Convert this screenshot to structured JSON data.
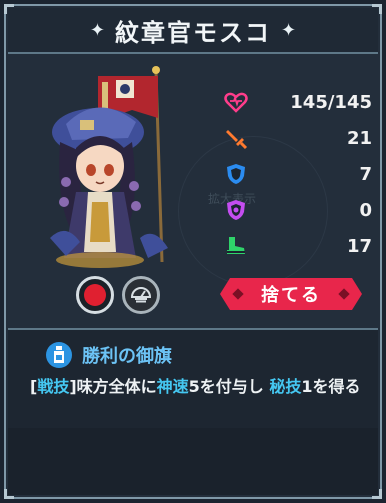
{
  "title": {
    "text": "紋章官モスコ",
    "spark": "✦"
  },
  "stats": {
    "hp": "145/145",
    "attack": "21",
    "defense": "7",
    "magic": "0",
    "speed": "17"
  },
  "watermark": {
    "text": "拡大表示"
  },
  "actions": {
    "discard_label": "捨てる"
  },
  "skill": {
    "name": "勝利の御旗",
    "desc_prefix": "[",
    "desc_tag": "戦技",
    "desc_mid1": "]味方全体に",
    "desc_kw1": "神速",
    "desc_mid2": "5を付与し ",
    "desc_kw2": "秘技",
    "desc_end": "1を得る"
  },
  "colors": {
    "hp_icon": "#ff3d8b",
    "attack_icon": "#ff7a2f",
    "defense_icon": "#2b8cf0",
    "magic_icon": "#c44df0",
    "speed_icon": "#2fd36a",
    "discard": "#e8264b",
    "highlight": "#45c8f2"
  }
}
